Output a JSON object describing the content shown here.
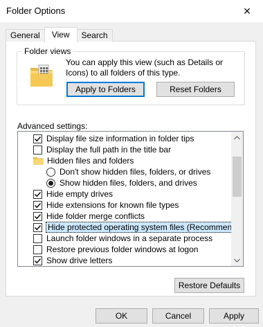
{
  "window": {
    "title": "Folder Options",
    "close_glyph": "✕"
  },
  "tabs": [
    {
      "label": "General",
      "active": false
    },
    {
      "label": "View",
      "active": true
    },
    {
      "label": "Search",
      "active": false
    }
  ],
  "folder_views": {
    "legend": "Folder views",
    "description": "You can apply this view (such as Details or Icons) to all folders of this type.",
    "apply_button": "Apply to Folders",
    "reset_button": "Reset Folders"
  },
  "advanced": {
    "label": "Advanced settings:",
    "items": [
      {
        "kind": "checkbox",
        "checked": true,
        "label": "Display file size information in folder tips"
      },
      {
        "kind": "checkbox",
        "checked": false,
        "label": "Display the full path in the title bar"
      },
      {
        "kind": "folder",
        "label": "Hidden files and folders"
      },
      {
        "kind": "radio",
        "checked": false,
        "label": "Don't show hidden files, folders, or drives"
      },
      {
        "kind": "radio",
        "checked": true,
        "label": "Show hidden files, folders, and drives"
      },
      {
        "kind": "checkbox",
        "checked": true,
        "label": "Hide empty drives"
      },
      {
        "kind": "checkbox",
        "checked": true,
        "label": "Hide extensions for known file types"
      },
      {
        "kind": "checkbox",
        "checked": true,
        "label": "Hide folder merge conflicts"
      },
      {
        "kind": "checkbox",
        "checked": true,
        "label": "Hide protected operating system files (Recommended)",
        "selected": true
      },
      {
        "kind": "checkbox",
        "checked": false,
        "label": "Launch folder windows in a separate process"
      },
      {
        "kind": "checkbox",
        "checked": false,
        "label": "Restore previous folder windows at logon"
      },
      {
        "kind": "checkbox",
        "checked": true,
        "label": "Show drive letters"
      }
    ],
    "restore_button": "Restore Defaults"
  },
  "footer": {
    "ok_button": "OK",
    "cancel_button": "Cancel",
    "apply_button": "Apply"
  },
  "colors": {
    "accent": "#0078d7",
    "selection_bg": "#cce8ff",
    "dialog_bg": "#f0f0f0"
  },
  "icons": [
    "close-icon",
    "folder-views-icon",
    "folder-icon",
    "checkmark-icon",
    "scroll-up-icon",
    "scroll-down-icon"
  ]
}
